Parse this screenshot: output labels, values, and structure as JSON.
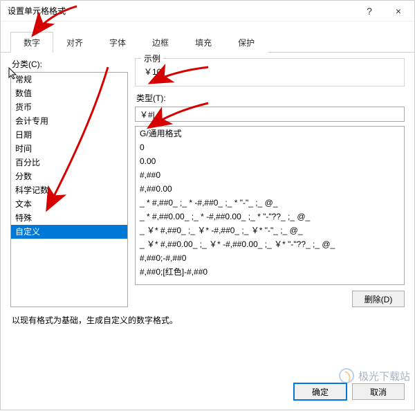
{
  "title": "设置单元格格式",
  "titlebar": {
    "help": "?",
    "close": "×"
  },
  "tabs": [
    "数字",
    "对齐",
    "字体",
    "边框",
    "填充",
    "保护"
  ],
  "active_tab_index": 0,
  "category_label": "分类(C):",
  "categories": [
    "常规",
    "数值",
    "货币",
    "会计专用",
    "日期",
    "时间",
    "百分比",
    "分数",
    "科学记数",
    "文本",
    "特殊",
    "自定义"
  ],
  "selected_category_index": 11,
  "sample_label": "示例",
  "sample_value": "￥10",
  "type_label": "类型(T):",
  "type_value": "￥#|",
  "formats": [
    "G/通用格式",
    "0",
    "0.00",
    "#,##0",
    "#,##0.00",
    "_ * #,##0_ ;_ * -#,##0_ ;_ * \"-\"_ ;_ @_ ",
    "_ * #,##0.00_ ;_ * -#,##0.00_ ;_ * \"-\"??_ ;_ @_ ",
    "_ ￥* #,##0_ ;_ ￥* -#,##0_ ;_ ￥* \"-\"_ ;_ @_ ",
    "_ ￥* #,##0.00_ ;_ ￥* -#,##0.00_ ;_ ￥* \"-\"??_ ;_ @_ ",
    "#,##0;-#,##0",
    "#,##0;[红色]-#,##0"
  ],
  "delete_label": "删除(D)",
  "hint": "以现有格式为基础，生成自定义的数字格式。",
  "ok_label": "确定",
  "cancel_label": "取消",
  "watermark": "极光下载站"
}
